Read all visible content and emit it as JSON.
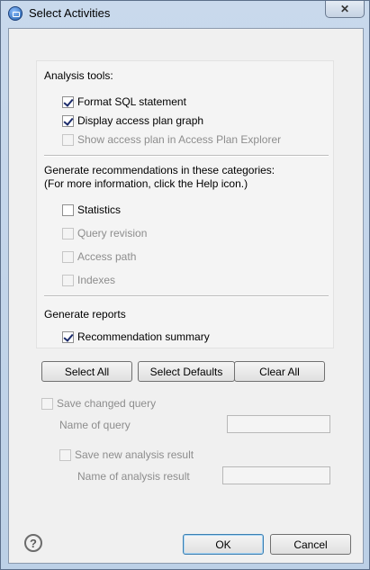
{
  "window": {
    "title": "Select Activities",
    "close_label": "✕"
  },
  "analysis_tools": {
    "heading": "Analysis tools:",
    "items": [
      {
        "label": "Format SQL statement",
        "checked": true,
        "enabled": true
      },
      {
        "label": "Display access plan graph",
        "checked": true,
        "enabled": true
      },
      {
        "label": "Show access plan in Access Plan Explorer",
        "checked": false,
        "enabled": false
      }
    ]
  },
  "recommendations": {
    "heading_line1": "Generate recommendations in these categories:",
    "heading_line2": "(For more information, click the Help icon.)",
    "items": [
      {
        "label": "Statistics",
        "checked": false,
        "enabled": true
      },
      {
        "label": "Query revision",
        "checked": false,
        "enabled": false
      },
      {
        "label": "Access path",
        "checked": false,
        "enabled": false
      },
      {
        "label": "Indexes",
        "checked": false,
        "enabled": false
      }
    ]
  },
  "reports": {
    "heading": "Generate reports",
    "items": [
      {
        "label": "Recommendation summary",
        "checked": true,
        "enabled": true
      }
    ]
  },
  "selection_buttons": {
    "select_all": "Select All",
    "select_defaults": "Select Defaults",
    "clear_all": "Clear All"
  },
  "save_query": {
    "label": "Save changed query",
    "checked": false,
    "enabled": false,
    "name_label": "Name of query",
    "name_value": ""
  },
  "save_analysis": {
    "label": "Save new analysis result",
    "checked": false,
    "enabled": false,
    "name_label": "Name of analysis result",
    "name_value": ""
  },
  "footer": {
    "help_icon": "?",
    "ok_label": "OK",
    "cancel_label": "Cancel"
  }
}
